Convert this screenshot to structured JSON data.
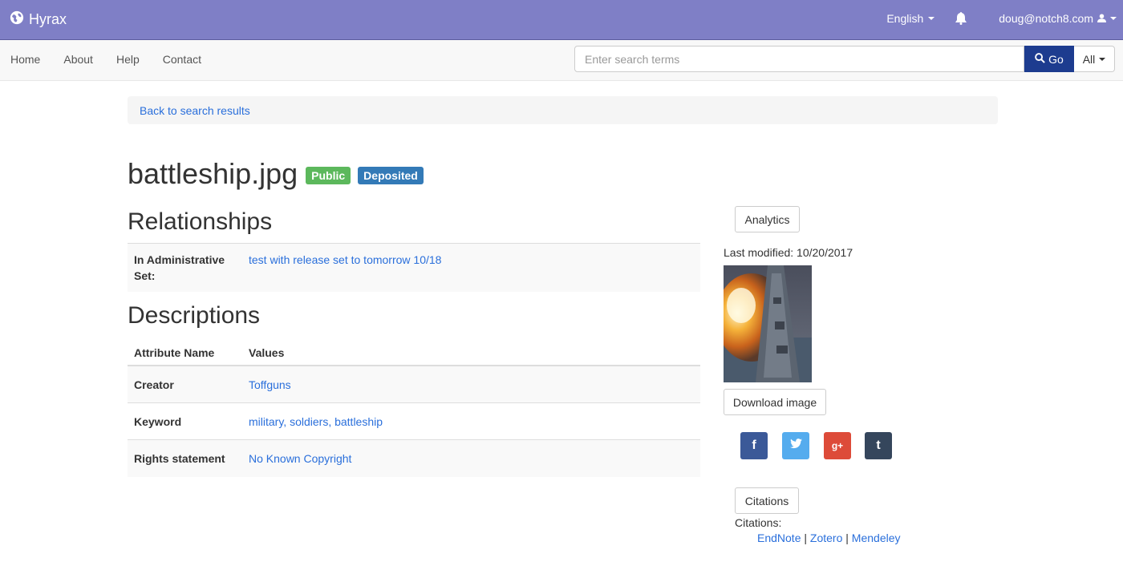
{
  "header": {
    "brand": "Hyrax",
    "language": "English",
    "user_email": "doug@notch8.com"
  },
  "nav": {
    "links": [
      "Home",
      "About",
      "Help",
      "Contact"
    ],
    "search_placeholder": "Enter search terms",
    "go_label": "Go",
    "scope_label": "All"
  },
  "breadcrumb": {
    "back_label": "Back to search results"
  },
  "work": {
    "title": "battleship.jpg",
    "visibility_badge": "Public",
    "status_badge": "Deposited"
  },
  "relationships": {
    "heading": "Relationships",
    "rows": [
      {
        "label": "In Administrative Set:",
        "value": "test with release set to tomorrow 10/18"
      }
    ]
  },
  "descriptions": {
    "heading": "Descriptions",
    "columns": [
      "Attribute Name",
      "Values"
    ],
    "rows": [
      {
        "label": "Creator",
        "value": "Toffguns"
      },
      {
        "label": "Keyword",
        "value": "military, soldiers, battleship"
      },
      {
        "label": "Rights statement",
        "value": "No Known Copyright"
      }
    ]
  },
  "sidebar": {
    "analytics_label": "Analytics",
    "last_modified": "Last modified: 10/20/2017",
    "download_label": "Download image",
    "social": [
      {
        "name": "facebook",
        "glyph": "f",
        "color": "#3b5998"
      },
      {
        "name": "twitter",
        "glyph": "t",
        "color": "#55acee"
      },
      {
        "name": "google-plus",
        "glyph": "g+",
        "color": "#dd4b39"
      },
      {
        "name": "tumblr",
        "glyph": "t",
        "color": "#35465c"
      }
    ],
    "citations_button": "Citations",
    "citations_label": "Citations:",
    "citation_links": [
      "EndNote",
      "Zotero",
      "Mendeley"
    ]
  },
  "colors": {
    "topbar": "#7f7fc6",
    "go_button": "#1d3c8f",
    "public_badge": "#5cb85c",
    "deposited_badge": "#337ab7",
    "link": "#2a6fdb"
  }
}
